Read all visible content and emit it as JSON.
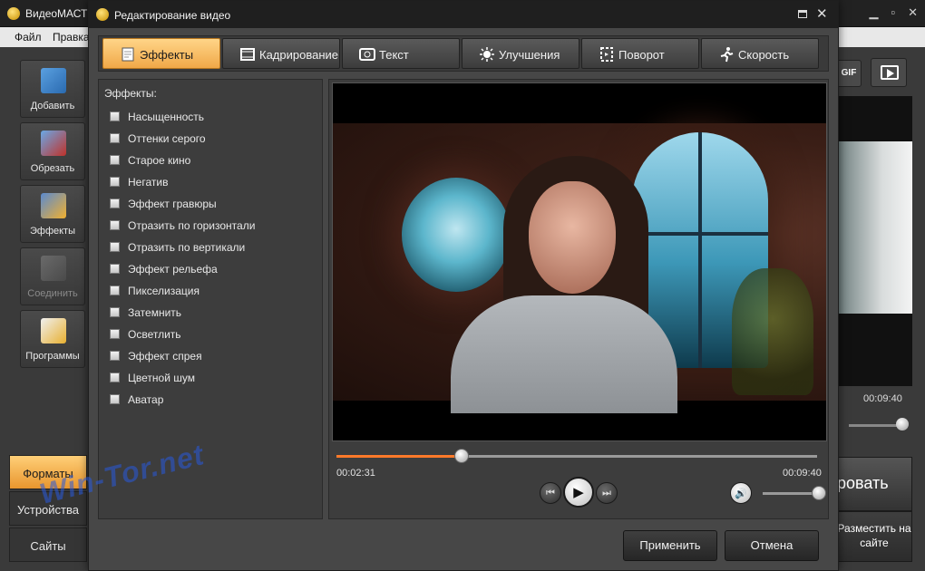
{
  "app": {
    "title": "ВидеоМАСТ",
    "menu": [
      "Файл",
      "Правка"
    ],
    "toolbar": [
      {
        "label": "Добавить",
        "icon": "film-add-icon",
        "enabled": true
      },
      {
        "label": "Обрезать",
        "icon": "film-scissors-icon",
        "enabled": true
      },
      {
        "label": "Эффекты",
        "icon": "magic-wand-icon",
        "enabled": true
      },
      {
        "label": "Соединить",
        "icon": "film-join-icon",
        "enabled": false
      },
      {
        "label": "Программы",
        "icon": "key-card-icon",
        "enabled": true
      }
    ],
    "nav": [
      "Форматы",
      "Устройства",
      "Сайты"
    ],
    "right": {
      "gif_label": "GIF",
      "time": "00:09:40",
      "convert_label": "ровать",
      "publish_label": "Разместить на сайте"
    }
  },
  "dialog": {
    "title": "Редактирование видео",
    "tabs": [
      {
        "label": "Эффекты",
        "icon": "effects-icon",
        "active": true
      },
      {
        "label": "Кадрирование",
        "icon": "crop-film-icon",
        "active": false
      },
      {
        "label": "Текст",
        "icon": "text-icon",
        "active": false
      },
      {
        "label": "Улучшения",
        "icon": "brightness-icon",
        "active": false
      },
      {
        "label": "Поворот",
        "icon": "rotate-icon",
        "active": false
      },
      {
        "label": "Скорость",
        "icon": "running-man-icon",
        "active": false
      }
    ],
    "effects_heading": "Эффекты:",
    "effects": [
      "Насыщенность",
      "Оттенки серого",
      "Старое кино",
      "Негатив",
      "Эффект гравюры",
      "Отразить по горизонтали",
      "Отразить по вертикали",
      "Эффект рельефа",
      "Пикселизация",
      "Затемнить",
      "Осветлить",
      "Эффект спрея",
      "Цветной шум",
      "Аватар"
    ],
    "player": {
      "current_time": "00:02:31",
      "total_time": "00:09:40",
      "progress": 0.26,
      "volume": 1.0
    },
    "apply_label": "Применить",
    "cancel_label": "Отмена"
  },
  "watermark": "Win-Tor.net",
  "colors": {
    "accent": "#f0a848",
    "seek_fill": "#ff7a2a"
  }
}
